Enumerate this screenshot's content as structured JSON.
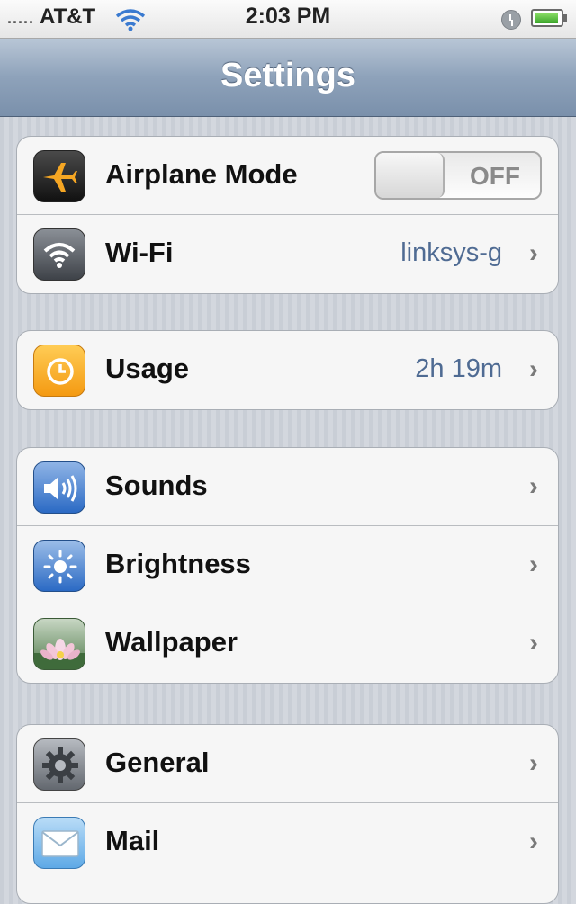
{
  "status_bar": {
    "carrier": "AT&T",
    "signal": ".....",
    "time": "2:03 PM"
  },
  "nav": {
    "title": "Settings"
  },
  "group1": {
    "airplane": {
      "label": "Airplane Mode",
      "toggle": "OFF",
      "icon": "airplane-icon"
    },
    "wifi": {
      "label": "Wi-Fi",
      "value": "linksys-g",
      "icon": "wifi-icon"
    }
  },
  "group2": {
    "usage": {
      "label": "Usage",
      "value": "2h 19m",
      "icon": "clock-icon"
    }
  },
  "group3": {
    "sounds": {
      "label": "Sounds",
      "icon": "speaker-icon"
    },
    "brightness": {
      "label": "Brightness",
      "icon": "sun-icon"
    },
    "wallpaper": {
      "label": "Wallpaper",
      "icon": "flower-icon"
    }
  },
  "group4": {
    "general": {
      "label": "General",
      "icon": "gear-icon"
    },
    "mail": {
      "label": "Mail",
      "icon": "envelope-icon"
    }
  },
  "chevron": "›",
  "colors": {
    "value_text": "#4f6b93",
    "navbar": "#8ea2ba"
  }
}
